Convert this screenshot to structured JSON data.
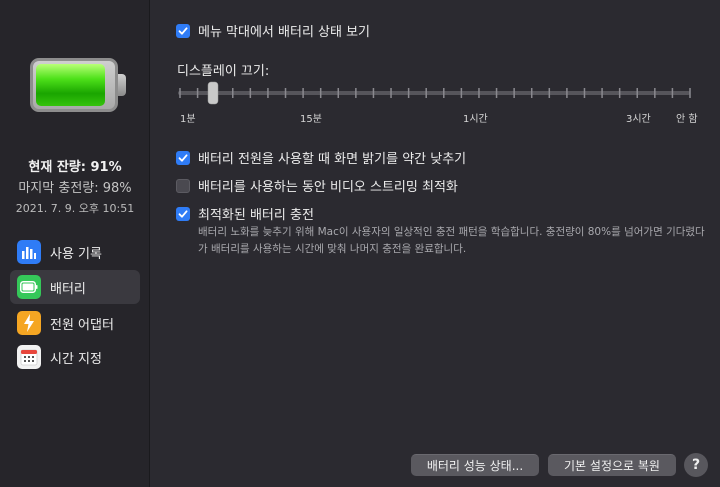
{
  "sidebar": {
    "current_charge": "현재 잔량: 91%",
    "last_charge": "마지막 충전량: 98%",
    "last_charge_date": "2021. 7. 9. 오후 10:51",
    "items": [
      {
        "label": "사용 기록",
        "icon": "bar-chart-icon",
        "selected": false
      },
      {
        "label": "배터리",
        "icon": "battery-icon",
        "selected": true
      },
      {
        "label": "전원 어댑터",
        "icon": "lightning-icon",
        "selected": false
      },
      {
        "label": "시간 지정",
        "icon": "calendar-icon",
        "selected": false
      }
    ]
  },
  "battery_level": 0.91,
  "main": {
    "show_in_menu_bar": {
      "label": "메뉴 막대에서 배터리 상태 보기",
      "checked": true
    },
    "display_off": {
      "label": "디스플레이 끄기:",
      "tick_labels": [
        "1분",
        "15분",
        "1시간",
        "3시간",
        "안 함"
      ],
      "value": "2분"
    },
    "dim_display": {
      "label": "배터리 전원을 사용할 때 화면 밝기를 약간 낮추기",
      "checked": true
    },
    "optimize_video": {
      "label": "배터리를 사용하는 동안 비디오 스트리밍 최적화",
      "checked": false
    },
    "optimized_charging": {
      "label": "최적화된 배터리 충전",
      "checked": true,
      "description": "배터리 노화를 늦추기 위해 Mac이 사용자의 일상적인 충전 패턴을 학습합니다. 충전량이 80%를 넘어가면 기다렸다가 배터리를 사용하는 시간에 맞춰 나머지 충전을 완료합니다."
    }
  },
  "buttons": {
    "battery_health": "배터리 성능 상태...",
    "restore_defaults": "기본 설정으로 복원",
    "help": "?"
  },
  "colors": {
    "accent": "#2f7cf6",
    "battery_green": "#35c759",
    "adapter_orange": "#f5a623"
  }
}
